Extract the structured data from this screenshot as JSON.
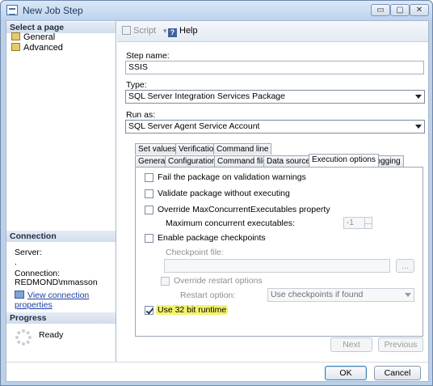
{
  "window": {
    "title": "New Job Step",
    "min_glyph": "▭",
    "max_glyph": "▢",
    "close_glyph": "✕"
  },
  "left": {
    "select_page_header": "Select a page",
    "pages": [
      "General",
      "Advanced"
    ],
    "connection_header": "Connection",
    "server_label": "Server:",
    "server_value": ".",
    "connection_label": "Connection:",
    "connection_value": "REDMOND\\mmasson",
    "view_connection_link": "View connection properties",
    "progress_header": "Progress",
    "progress_status": "Ready"
  },
  "toolbar": {
    "script_label": "Script",
    "script_dropdown": "▼",
    "help_label": "Help",
    "help_glyph": "?"
  },
  "form": {
    "step_name_label": "Step name:",
    "step_name_value": "SSIS",
    "type_label": "Type:",
    "type_value": "SQL Server Integration Services Package",
    "run_as_label": "Run as:",
    "run_as_value": "SQL Server Agent Service Account"
  },
  "tabs": {
    "row1": [
      "Set values",
      "Verification",
      "Command line"
    ],
    "row2": [
      "General",
      "Configurations",
      "Command files",
      "Data sources",
      "Execution options",
      "Logging"
    ],
    "active": "Execution options"
  },
  "execution": {
    "fail_on_warnings": {
      "label": "Fail the package on validation warnings",
      "checked": false
    },
    "validate_only": {
      "label": "Validate package without executing",
      "checked": false
    },
    "override_max": {
      "label": "Override MaxConcurrentExecutables property",
      "checked": false
    },
    "max_concurrent_label": "Maximum concurrent executables:",
    "max_concurrent_value": "-1",
    "enable_checkpoints": {
      "label": "Enable package checkpoints",
      "checked": false
    },
    "checkpoint_file_label": "Checkpoint file:",
    "checkpoint_file_value": "",
    "browse_label": "...",
    "override_restart": {
      "label": "Override restart options",
      "checked": false
    },
    "restart_option_label": "Restart option:",
    "restart_option_value": "Use checkpoints if found",
    "use_32bit": {
      "label": "Use 32 bit runtime",
      "checked": true
    },
    "highlight_color": "#f3f36a"
  },
  "nav": {
    "next_label": "Next",
    "previous_label": "Previous"
  },
  "footer": {
    "ok_label": "OK",
    "cancel_label": "Cancel"
  }
}
